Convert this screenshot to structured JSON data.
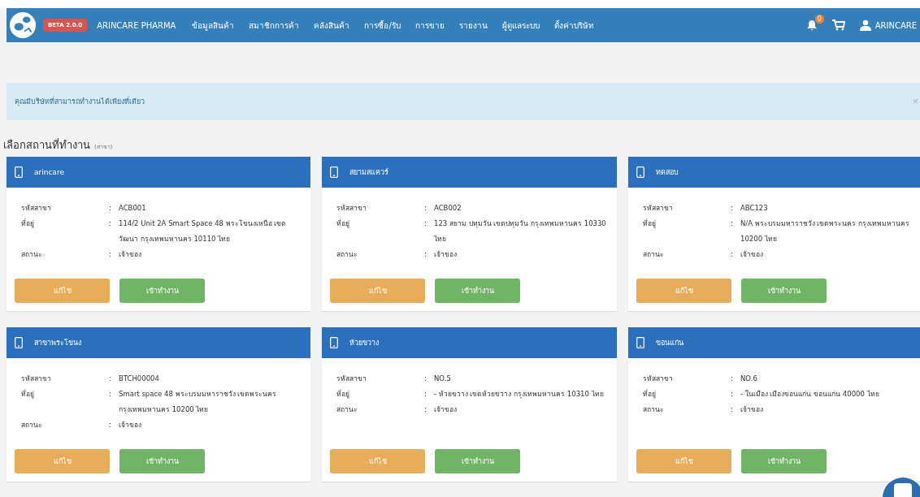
{
  "navbar": {
    "badge": "BETA 2.0.0",
    "brand": "ARINCARE PHARMA",
    "menu": [
      "ข้อมูลสินค้า",
      "สมาชิกการค้า",
      "คลังสินค้า",
      "การซื้อ/รับ",
      "การขาย",
      "รายงาน",
      "ผู้ดูแลระบบ",
      "ตั้งค่าบริษัท"
    ],
    "notification_count": "0",
    "user": "ARINCARE"
  },
  "alert": {
    "text": "คุณมีบริษัทที่สามารถทำงานได้เพียงที่เดียว",
    "close": "×"
  },
  "heading": {
    "title": "เลือกสถานที่ทำงาน",
    "subtitle": "(สาขา)"
  },
  "branches": [
    {
      "name": "arincare",
      "fields": [
        {
          "label": "รหัสสาขา",
          "separator": ":",
          "value": "ACB001"
        },
        {
          "label": "ที่อยู่",
          "separator": ":",
          "value": "114/2 Unit 2A Smart Space 48 พระโขนงเหนือ เขตวัฒนา กรุงเทพมหานคร 10110 ไทย"
        },
        {
          "label": "สถานะ",
          "separator": ":",
          "value": "เจ้าของ"
        }
      ],
      "edit": "แก้ไข",
      "enter": "เข้าทำงาน"
    },
    {
      "name": "สยามสแควร์",
      "fields": [
        {
          "label": "รหัสสาขา",
          "separator": ":",
          "value": "ACB002"
        },
        {
          "label": "ที่อยู่",
          "separator": ":",
          "value": "123 สยาม ปทุมวัน เขตปทุมวัน กรุงเทพมหานคร 10330 ไทย"
        },
        {
          "label": "สถานะ",
          "separator": ":",
          "value": "เจ้าของ"
        }
      ],
      "edit": "แก้ไข",
      "enter": "เข้าทำงาน"
    },
    {
      "name": "ทดสอบ",
      "fields": [
        {
          "label": "รหัสสาขา",
          "separator": ":",
          "value": "ABC123"
        },
        {
          "label": "ที่อยู่",
          "separator": ":",
          "value": "N/A พระบรมมหาราชวัง เขตพระนคร กรุงเทพมหานคร 10200 ไทย"
        },
        {
          "label": "สถานะ",
          "separator": ":",
          "value": "เจ้าของ"
        }
      ],
      "edit": "แก้ไข",
      "enter": "เข้าทำงาน"
    },
    {
      "name": "สาขาพระโขนง",
      "fields": [
        {
          "label": "รหัสสาขา",
          "separator": ":",
          "value": "BTCH00004"
        },
        {
          "label": "ที่อยู่",
          "separator": ":",
          "value": "Smart space 48 พระบรมมหาราชวัง เขตพระนคร กรุงเทพมหานคร 10200 ไทย"
        },
        {
          "label": "สถานะ",
          "separator": ":",
          "value": "เจ้าของ"
        }
      ],
      "edit": "แก้ไข",
      "enter": "เข้าทำงาน"
    },
    {
      "name": "ห้วยขวาง",
      "fields": [
        {
          "label": "รหัสสาขา",
          "separator": ":",
          "value": "NO.5"
        },
        {
          "label": "ที่อยู่",
          "separator": ":",
          "value": "- ห้วยขวาง เขตห้วยขวาง กรุงเทพมหานคร 10310 ไทย"
        },
        {
          "label": "สถานะ",
          "separator": ":",
          "value": "เจ้าของ"
        }
      ],
      "edit": "แก้ไข",
      "enter": "เข้าทำงาน"
    },
    {
      "name": "ขอนแก่น",
      "fields": [
        {
          "label": "รหัสสาขา",
          "separator": ":",
          "value": "NO.6"
        },
        {
          "label": "ที่อยู่",
          "separator": ":",
          "value": "- ในเมือง เมืองขอนแก่น ขอนแก่น 40000 ไทย"
        },
        {
          "label": "สถานะ",
          "separator": ":",
          "value": "เจ้าของ"
        }
      ],
      "edit": "แก้ไข",
      "enter": "เข้าทำงาน"
    }
  ]
}
